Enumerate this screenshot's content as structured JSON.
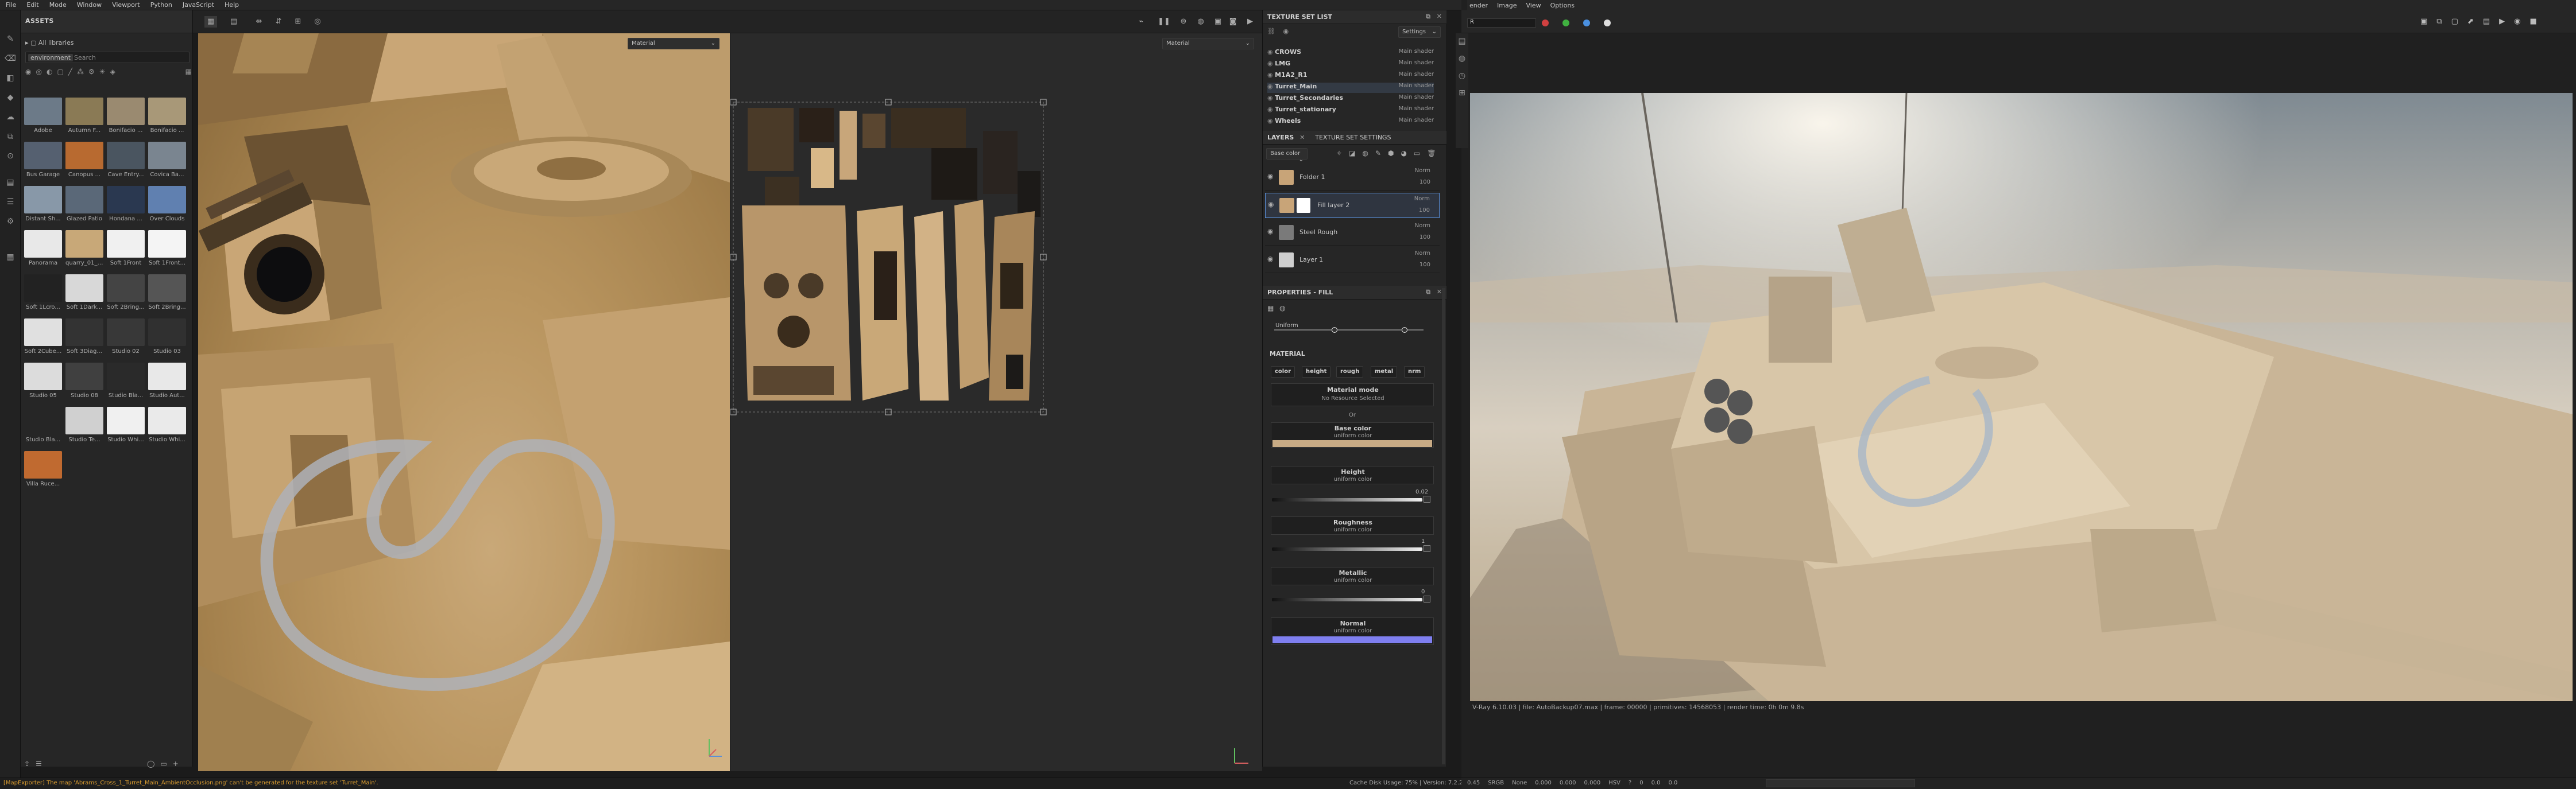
{
  "menu": [
    "File",
    "Edit",
    "Mode",
    "Window",
    "Viewport",
    "Python",
    "JavaScript",
    "Help"
  ],
  "vray_menu": [
    "ender",
    "Image",
    "View",
    "Options"
  ],
  "assets": {
    "title": "ASSETS",
    "library": "All libraries",
    "filter_tag": "environment",
    "search_placeholder": "Search",
    "items": [
      "Adobe",
      "Autumn F...",
      "Bonifacio ...",
      "Bonifacio ...",
      "Bus Garage",
      "Canopus ...",
      "Cave Entry...",
      "Covica Ba...",
      "Distant Sh...",
      "Glazed Patio",
      "Hondana ...",
      "Over Clouds",
      "Panorama",
      "quarry_01_4k",
      "Soft 1Front",
      "Soft 1Front...",
      "Soft 1Lcro...",
      "Soft 1Dark...",
      "Soft 2Bring...",
      "Soft 2Bring...",
      "Soft 2Cube...",
      "Soft 3Diag...",
      "Studio 02",
      "Studio 03",
      "Studio 05",
      "Studio 08",
      "Studio Bla...",
      "Studio Aut...",
      "Studio Bla...",
      "Studio Te...",
      "Studio Whi...",
      "Studio Whi...",
      "Villa Ruce..."
    ],
    "thumb_colors": [
      "#6c7a88",
      "#8a7a55",
      "#9a8a70",
      "#a89878",
      "#556070",
      "#b86a30",
      "#4a5560",
      "#7a8590",
      "#8898a8",
      "#5a6878",
      "#2a3850",
      "#6080b0",
      "#e8e8e8",
      "#c8a878",
      "#f0f0f0",
      "#f4f4f4",
      "#222222",
      "#d8d8d8",
      "#444444",
      "#555555",
      "#e0e0e0",
      "#333333",
      "#383838",
      "#303030",
      "#dcdcdc",
      "#404040",
      "#2a2a2a",
      "#e8e8e8",
      "#262626",
      "#d0d0d0",
      "#f0f0f0",
      "#eaeaea",
      "#c06a30"
    ]
  },
  "viewport": {
    "material_dropdown_left": "Material",
    "material_dropdown_right": "Material"
  },
  "texture_set_list": {
    "title": "TEXTURE SET LIST",
    "settings_label": "Settings",
    "rows": [
      {
        "name": "CROWS",
        "shader": "Main shader"
      },
      {
        "name": "LMG",
        "shader": "Main shader"
      },
      {
        "name": "M1A2_R1",
        "shader": "Main shader"
      },
      {
        "name": "Turret_Main",
        "shader": "Main shader"
      },
      {
        "name": "Turret_Secondaries",
        "shader": "Main shader"
      },
      {
        "name": "Turret_stationary",
        "shader": "Main shader"
      },
      {
        "name": "Wheels",
        "shader": "Main shader"
      }
    ]
  },
  "layers": {
    "tab_layers": "LAYERS",
    "tab_settings": "TEXTURE SET SETTINGS",
    "channel": "Base color",
    "items": [
      {
        "name": "Folder 1",
        "blend": "Norm",
        "opacity": "100"
      },
      {
        "name": "Fill layer 2",
        "blend": "Norm",
        "opacity": "100"
      },
      {
        "name": "Steel Rough",
        "blend": "Norm",
        "opacity": "100"
      },
      {
        "name": "Layer 1",
        "blend": "Norm",
        "opacity": "100"
      }
    ]
  },
  "properties": {
    "title": "PROPERTIES - FILL",
    "uniform_label": "Uniform",
    "material_header": "MATERIAL",
    "channels": [
      "color",
      "height",
      "rough",
      "metal",
      "nrm"
    ],
    "material_mode_label": "Material mode",
    "material_mode_value": "No Resource Selected",
    "or_label": "Or",
    "base_color": {
      "title": "Base color",
      "sub": "uniform color",
      "swatch": "#c8ab85"
    },
    "height": {
      "title": "Height",
      "sub": "uniform color",
      "value": "0.02"
    },
    "roughness": {
      "title": "Roughness",
      "sub": "uniform color",
      "value": "1"
    },
    "metallic": {
      "title": "Metallic",
      "sub": "uniform color",
      "value": "0"
    },
    "normal": {
      "title": "Normal",
      "sub": "uniform color",
      "swatch": "#7f7ff0"
    }
  },
  "vray": {
    "search_value": "R",
    "status": "V-Ray 6.10.03  |  file: AutoBackup07.max  |  frame: 00000  |  primitives: 14568053  |  render time: 0h  0m  9.8s",
    "bottom_fields": [
      "0.45",
      "SRGB",
      "None",
      "0.000",
      "0.000",
      "0.000",
      "HSV",
      "?",
      "0",
      "0.0",
      "0.0"
    ]
  },
  "status": {
    "error": "[MapExporter] The map 'Abrams_Cross_1_Turret_Main_AmbientOcclusion.png' can't be generated for the texture set 'Turret_Main'.",
    "cache": "Cache Disk Usage:   75%  |  Version: 7.2.2"
  },
  "colors": {
    "accent_blue": "#5a8fd8",
    "normal_swatch": "#7f7ff0",
    "error_text": "#e0a030"
  }
}
